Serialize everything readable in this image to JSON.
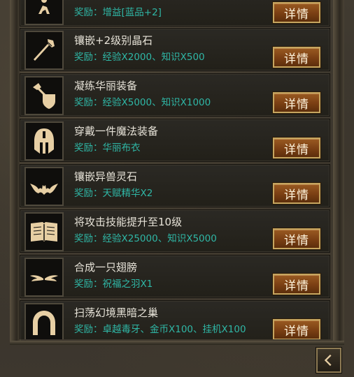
{
  "button_label": "详情",
  "icon_color": "#e7cfa4",
  "title_color": "#e7e3d8",
  "reward_color": "#2fb7a6",
  "tasks": [
    {
      "icon": "kneeling-figure-icon",
      "title": "",
      "reward": "奖励：增益[蓝品+2]"
    },
    {
      "icon": "crystal-spear-icon",
      "title": "镶嵌+2级别晶石",
      "reward": "奖励：经验X2000、知识X500"
    },
    {
      "icon": "axe-shield-icon",
      "title": "凝练华丽装备",
      "reward": "奖励：经验X5000、知识X1000"
    },
    {
      "icon": "helmet-icon",
      "title": "穿戴一件魔法装备",
      "reward": "奖励：华丽布衣"
    },
    {
      "icon": "bat-icon",
      "title": "镶嵌异兽灵石",
      "reward": "奖励：天赋精华X2"
    },
    {
      "icon": "open-book-icon",
      "title": "将攻击技能提升至10级",
      "reward": "奖励：经验X25000、知识X5000"
    },
    {
      "icon": "wings-icon",
      "title": "合成一只翅膀",
      "reward": "奖励：祝福之羽X1"
    },
    {
      "icon": "arch-gate-icon",
      "title": "扫荡幻境黑暗之巢",
      "reward": "奖励：卓越毒牙、金币X100、挂机X100"
    }
  ],
  "back_icon": "back-arrow-icon"
}
